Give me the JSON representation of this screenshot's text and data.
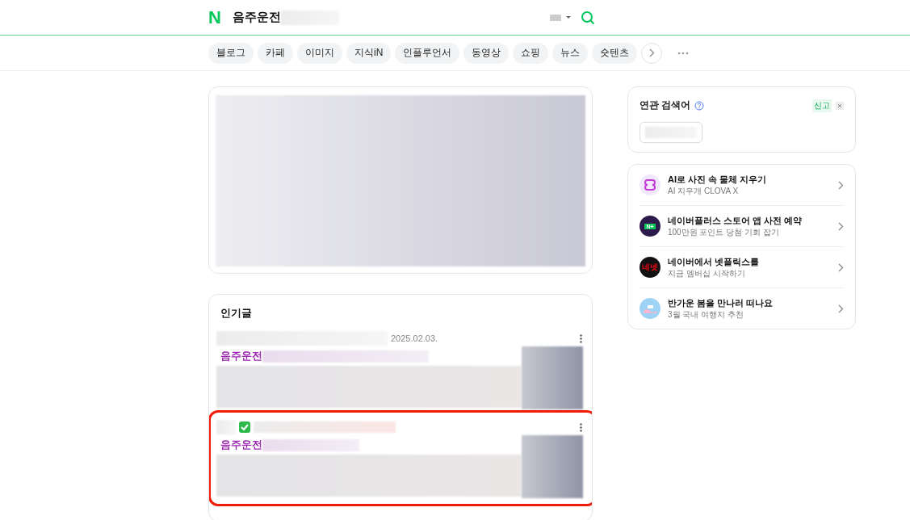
{
  "header": {
    "logo": "N",
    "query": "음주운전"
  },
  "tabs": [
    {
      "label": "블로그",
      "selected": false
    },
    {
      "label": "카페",
      "selected": false
    },
    {
      "label": "이미지",
      "selected": false
    },
    {
      "label": "지식iN",
      "selected": false
    },
    {
      "label": "인플루언서",
      "selected": false
    },
    {
      "label": "동영상",
      "selected": false
    },
    {
      "label": "쇼핑",
      "selected": false
    },
    {
      "label": "뉴스",
      "selected": false
    },
    {
      "label": "숏텐츠",
      "selected": false
    }
  ],
  "related": {
    "title": "연관 검색어",
    "report": "신고"
  },
  "promos": [
    {
      "kind": "clova",
      "title": "AI로 사진 속 물체 지우기",
      "subtitle": "AI 지우개 CLOVA X"
    },
    {
      "kind": "nplus",
      "badge": "N+",
      "title": "네이버플러스 스토어 앱 사전 예약",
      "subtitle": "100만원 포인트 당첨 기회 잡기"
    },
    {
      "kind": "netflix",
      "badge": "네넷",
      "title": "네이버에서 넷플릭스를",
      "subtitle": "지금 멤버십 시작하기"
    },
    {
      "kind": "travel",
      "title": "반가운 봄을 만나러 떠나요",
      "subtitle": "3월 국내 여행지 추천"
    }
  ],
  "popular": {
    "title": "인기글",
    "posts": [
      {
        "date": "2025.02.03.",
        "title": "음주운전",
        "verified": false,
        "highlighted": false
      },
      {
        "title": "음주운전",
        "verified": true,
        "highlighted": true
      }
    ]
  }
}
